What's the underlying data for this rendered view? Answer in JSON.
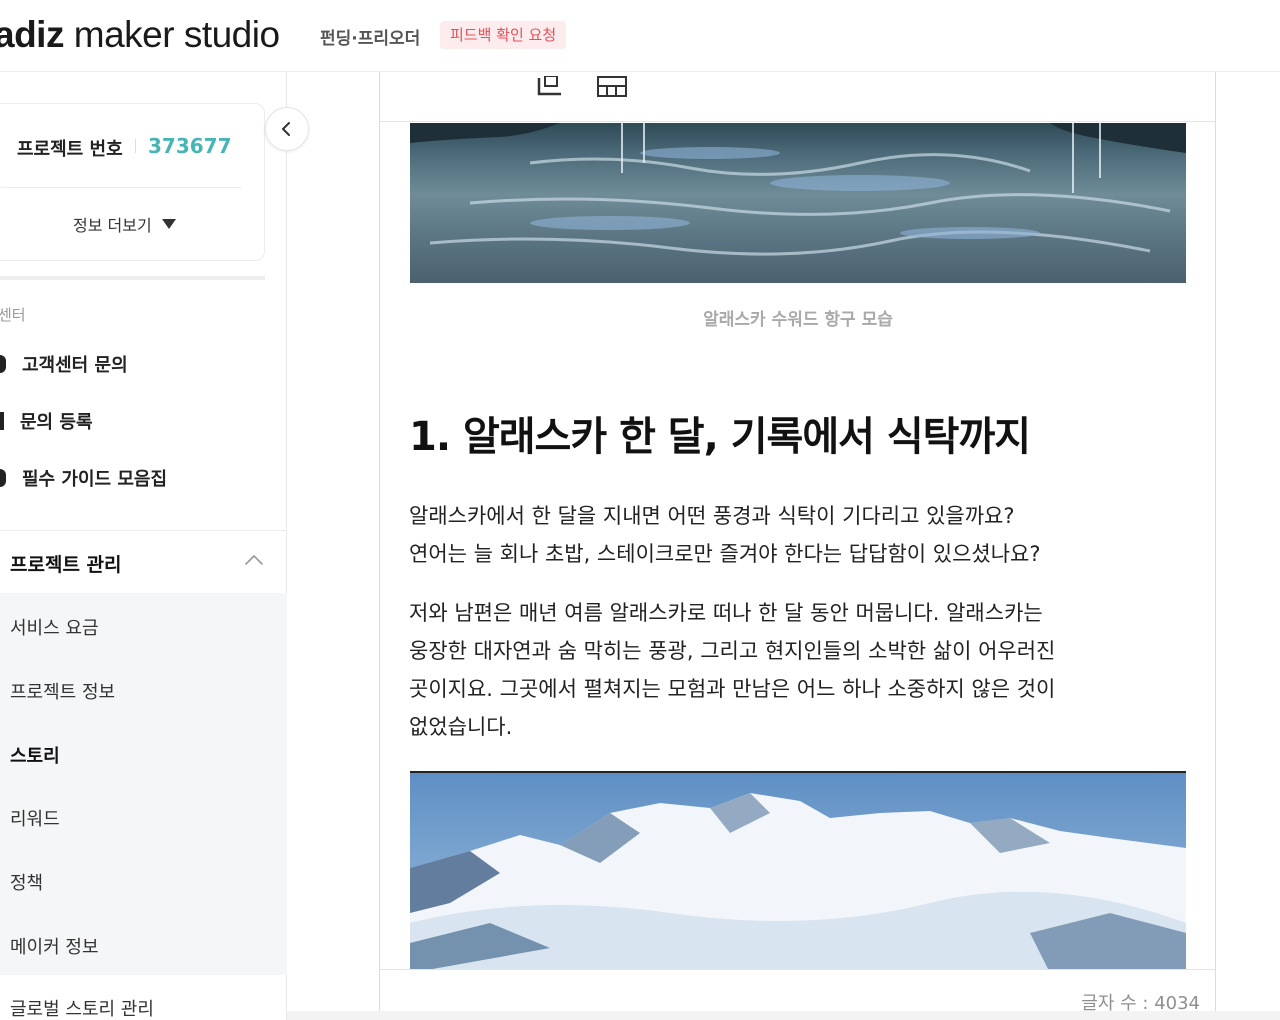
{
  "header": {
    "logo_bold": "adiz",
    "logo_rest": " maker studio",
    "subtitle": "펀딩·프리오더",
    "badge": "피드백 확인 요청"
  },
  "sidebar": {
    "project_label": "프로젝트 번호",
    "project_number": "373677",
    "more_info": "정보 더보기",
    "section_label": "센터",
    "support_items": [
      {
        "label": "고객센터 문의"
      },
      {
        "label": "문의 등록"
      },
      {
        "label": "필수 가이드 모음집"
      }
    ],
    "menu_head": "프로젝트 관리",
    "sub_items": [
      {
        "label": "서비스 요금"
      },
      {
        "label": "프로젝트 정보"
      },
      {
        "label": "스토리"
      },
      {
        "label": "리워드"
      },
      {
        "label": "정책"
      },
      {
        "label": "메이커 정보"
      }
    ],
    "global_item": "글로벌 스토리 관리"
  },
  "editor": {
    "caption": "알래스카 수워드 항구 모습",
    "heading": "1. 알래스카 한 달, 기록에서 식탁까지",
    "paragraph1": [
      "알래스카에서 한 달을 지내면 어떤 풍경과 식탁이 기다리고 있을까요?",
      "연어는 늘 회나 초밥, 스테이크로만 즐겨야 한다는 답답함이 있으셨나요?"
    ],
    "paragraph2": [
      "저와 남편은 매년 여름 알래스카로 떠나 한 달 동안 머뭅니다. 알래스카는",
      "웅장한 대자연과 숨 막히는 풍광, 그리고 현지인들의 소박한 삶이 어우러진",
      "곳이지요. 그곳에서 펼쳐지는 모험과 만남은 어느 하나 소중하지 않은 것이",
      "없었습니다."
    ],
    "word_count": "글자 수 : 4034"
  }
}
